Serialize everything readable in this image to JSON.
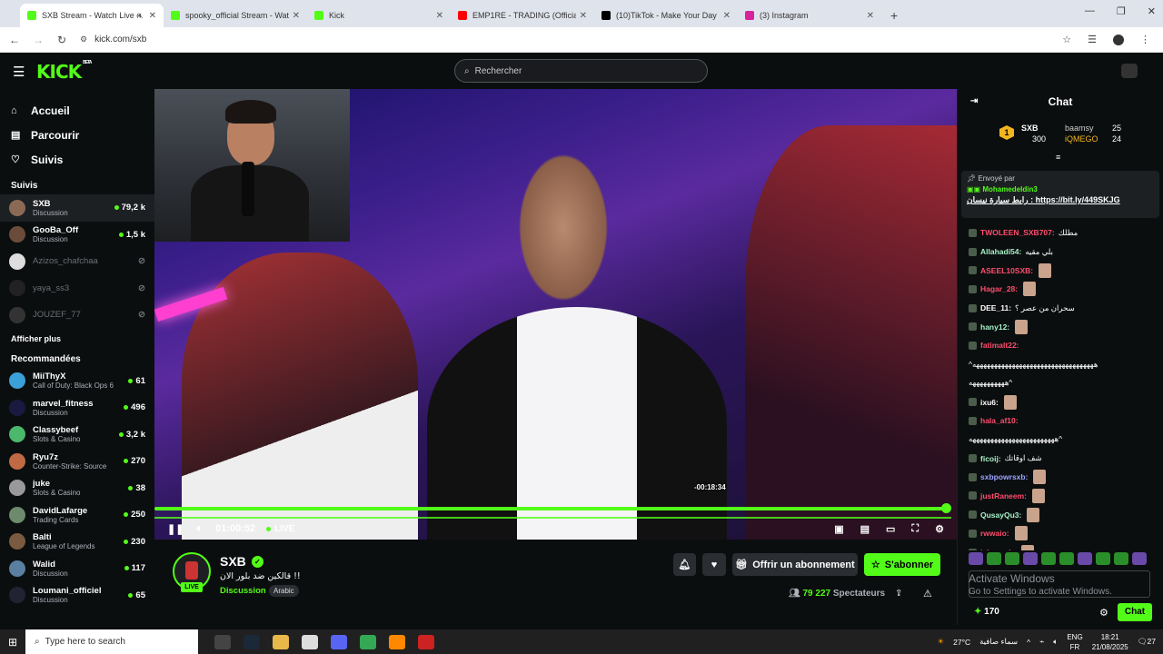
{
  "browser": {
    "tabs": [
      {
        "title": "SXB Stream - Watch Live on Kick",
        "color": "#53fc18",
        "active": true
      },
      {
        "title": "spooky_official Stream - Watch",
        "color": "#53fc18",
        "active": false
      },
      {
        "title": "Kick",
        "color": "#53fc18",
        "active": false
      },
      {
        "title": "EMP1RE - TRADING (Official M",
        "color": "#ff0000",
        "active": false
      },
      {
        "title": "(10)TikTok - Make Your Day",
        "color": "#000000",
        "active": false
      },
      {
        "title": "(3) Instagram",
        "color": "#d6249f",
        "active": false
      }
    ],
    "url": "kick.com/sxb"
  },
  "header": {
    "logo": "KICK",
    "logo_badge": "BETA",
    "search_placeholder": "Rechercher"
  },
  "sidebar": {
    "nav": [
      {
        "label": "Accueil",
        "icon": "home-icon"
      },
      {
        "label": "Parcourir",
        "icon": "browse-icon"
      },
      {
        "label": "Suivis",
        "icon": "heart-icon"
      }
    ],
    "followed_title": "Suivis",
    "followed": [
      {
        "name": "SXB",
        "category": "Discussion",
        "viewers": "79,2 k",
        "online": true,
        "color": "#8b6a55"
      },
      {
        "name": "GooBa_Off",
        "category": "Discussion",
        "viewers": "1,5 k",
        "online": true,
        "color": "#6b4c3b"
      },
      {
        "name": "Azizos_chafchaa",
        "category": "",
        "viewers": "",
        "online": false,
        "color": "#ddd"
      },
      {
        "name": "yaya_ss3",
        "category": "",
        "viewers": "",
        "online": false,
        "color": "#222"
      },
      {
        "name": "JOUZEF_77",
        "category": "",
        "viewers": "",
        "online": false,
        "color": "#333"
      }
    ],
    "show_more": "Afficher plus",
    "recommended_title": "Recommandées",
    "recommended": [
      {
        "name": "MiiThyX",
        "category": "Call of Duty: Black Ops 6",
        "viewers": "61",
        "color": "#3ba0d8"
      },
      {
        "name": "marvel_fitness",
        "category": "Discussion",
        "viewers": "496",
        "color": "#1a1a40"
      },
      {
        "name": "Classybeef",
        "category": "Slots & Casino",
        "viewers": "3,2 k",
        "color": "#4bb86b"
      },
      {
        "name": "Ryu7z",
        "category": "Counter-Strike: Source",
        "viewers": "270",
        "color": "#c06a45"
      },
      {
        "name": "juke",
        "category": "Slots & Casino",
        "viewers": "38",
        "color": "#999"
      },
      {
        "name": "DavidLafarge",
        "category": "Trading Cards",
        "viewers": "250",
        "color": "#6d8a6d"
      },
      {
        "name": "Balti",
        "category": "League of Legends",
        "viewers": "230",
        "color": "#7a5a40"
      },
      {
        "name": "Walid",
        "category": "Discussion",
        "viewers": "117",
        "color": "#5a7fa0"
      },
      {
        "name": "Loumani_officiel",
        "category": "Discussion",
        "viewers": "65",
        "color": "#223"
      }
    ]
  },
  "player": {
    "tooltip_time": "-00:18:34",
    "elapsed": "01:00:52",
    "live_label": "LIVE",
    "progress_fraction": 0.993
  },
  "stream": {
    "streamer": "SXB",
    "title": "!! قالكين ضد بلور الان",
    "category": "Discussion",
    "tag": "Arabic",
    "live_badge": "LIVE",
    "gift_label": "Offrir un abonnement",
    "subscribe_label": "S'abonner",
    "viewers": "79 227",
    "viewers_label": "Spectateurs"
  },
  "chat": {
    "title": "Chat",
    "leaderboard": {
      "rank": "1",
      "top_name": "SXB",
      "top_value": "300",
      "second_name": "baamsy",
      "second_value": "25",
      "third_name": "iQMEGO",
      "third_value": "24"
    },
    "pinned": {
      "sent_by_label": "Envoyé par",
      "sender": "Mohamedeldin3",
      "text": "رابط سيارة نيسان :",
      "link": "https://bit.ly/449SKJG"
    },
    "messages": [
      {
        "user": "TWOLEEN_SXB707:",
        "text": "مطلك",
        "color": "#ff4d6d",
        "emote": false
      },
      {
        "user": "Allahadi54:",
        "text": "بلي مقيه",
        "color": "#a6f3c9",
        "emote": false
      },
      {
        "user": "ASEEL10SXB:",
        "text": "",
        "color": "#ff4d6d",
        "emote": true
      },
      {
        "user": "Hagar_28:",
        "text": "",
        "color": "#ff4d6d",
        "emote": true
      },
      {
        "user": "DEE_11:",
        "text": "سحران من عصر ؟",
        "color": "#ffffff",
        "emote": false
      },
      {
        "user": "hany12:",
        "text": "",
        "color": "#a6f3c9",
        "emote": true
      },
      {
        "user": "fatimalt22:",
        "text": "",
        "color": "#ff4d6d",
        "emote": false
      },
      {
        "user": "",
        "text": "ههههههههههههههههههههههههههههههههههه^",
        "color": "#ffffff",
        "emote": false
      },
      {
        "user": "",
        "text": "^ههههههههههه",
        "color": "#ffffff",
        "emote": false
      },
      {
        "user": "ixu6:",
        "text": "",
        "color": "#ffffff",
        "emote": true
      },
      {
        "user": "hala_af10:",
        "text": "",
        "color": "#ff4d6d",
        "emote": false
      },
      {
        "user": "",
        "text": "^ههههههههههههههههههههههههه",
        "color": "#ffffff",
        "emote": false
      },
      {
        "user": "ficoij:",
        "text": "شف اوقاتك",
        "color": "#a6f3c9",
        "emote": false
      },
      {
        "user": "sxbpowrsxb:",
        "text": "",
        "color": "#9aa4ff",
        "emote": true
      },
      {
        "user": "justRaneem:",
        "text": "",
        "color": "#ff4d6d",
        "emote": true
      },
      {
        "user": "QusayQu3:",
        "text": "",
        "color": "#a6f3c9",
        "emote": true
      },
      {
        "user": "rwwaio:",
        "text": "",
        "color": "#ff4d6d",
        "emote": true
      },
      {
        "user": "isha_axb:",
        "text": "",
        "color": "#ff4d6d",
        "emote": true
      }
    ],
    "input_placeholder": "Envoyer un message",
    "windows_activate": "Activate Windows",
    "windows_activate_sub": "Go to Settings to activate Windows.",
    "points": "170",
    "send_label": "Chat"
  },
  "taskbar": {
    "search_placeholder": "Type here to search",
    "weather": "27°C",
    "weather_text": "سماء صافية",
    "lang": "ENG",
    "lang2": "FR",
    "time": "18:21",
    "date": "21/08/2025",
    "notif": "27"
  }
}
